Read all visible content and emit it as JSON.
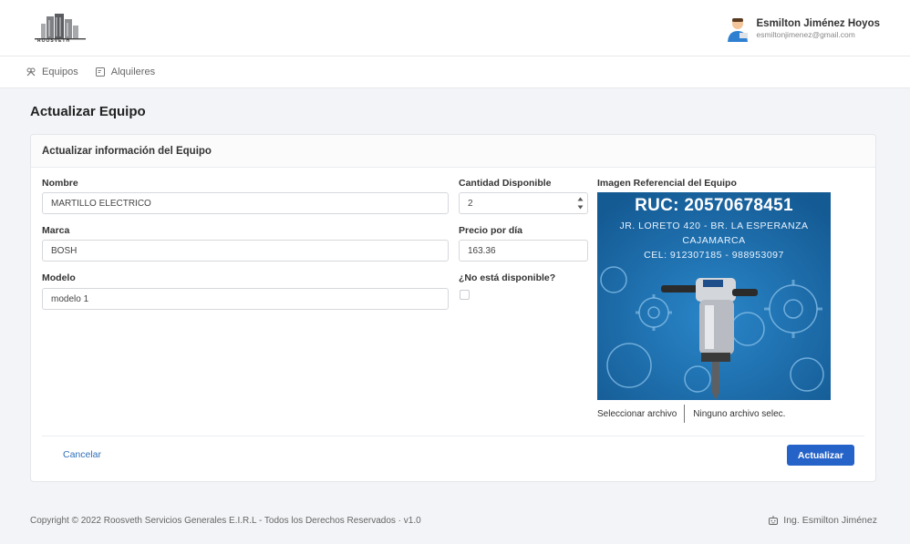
{
  "header": {
    "logo_text": "ROOSVETH",
    "user_name": "Esmilton Jiménez Hoyos",
    "user_email": "esmiltonjimenez@gmail.com"
  },
  "nav": {
    "items": [
      {
        "label": "Equipos",
        "icon": "tools-icon"
      },
      {
        "label": "Alquileres",
        "icon": "document-icon"
      }
    ]
  },
  "page": {
    "title": "Actualizar Equipo",
    "card_title": "Actualizar información del Equipo"
  },
  "form": {
    "nombre_label": "Nombre",
    "nombre_value": "MARTILLO ELECTRICO",
    "marca_label": "Marca",
    "marca_value": "BOSH",
    "modelo_label": "Modelo",
    "modelo_value": "modelo 1",
    "cantidad_label": "Cantidad Disponible",
    "cantidad_value": "2",
    "precio_label": "Precio por día",
    "precio_value": "163.36",
    "disponible_label": "¿No está disponible?",
    "imagen_label": "Imagen Referencial del Equipo",
    "file_button": "Seleccionar archivo",
    "file_name": "Ninguno archivo selec."
  },
  "image": {
    "ruc": "RUC: 20570678451",
    "line1": "JR. LORETO 420 - BR. LA ESPERANZA",
    "line2": "CAJAMARCA",
    "line3": "CEL: 912307185 - 988953097"
  },
  "actions": {
    "cancel_label": "Cancelar",
    "update_label": "Actualizar"
  },
  "footer": {
    "copyright": "Copyright © 2022 Roosveth Servicios Generales E.I.R.L - Todos los Derechos Reservados  ·  v1.0",
    "author": "Ing. Esmilton Jiménez"
  },
  "colors": {
    "primary": "#2563c9",
    "image_bg": "#1b6fae",
    "background": "#f2f4f7"
  }
}
